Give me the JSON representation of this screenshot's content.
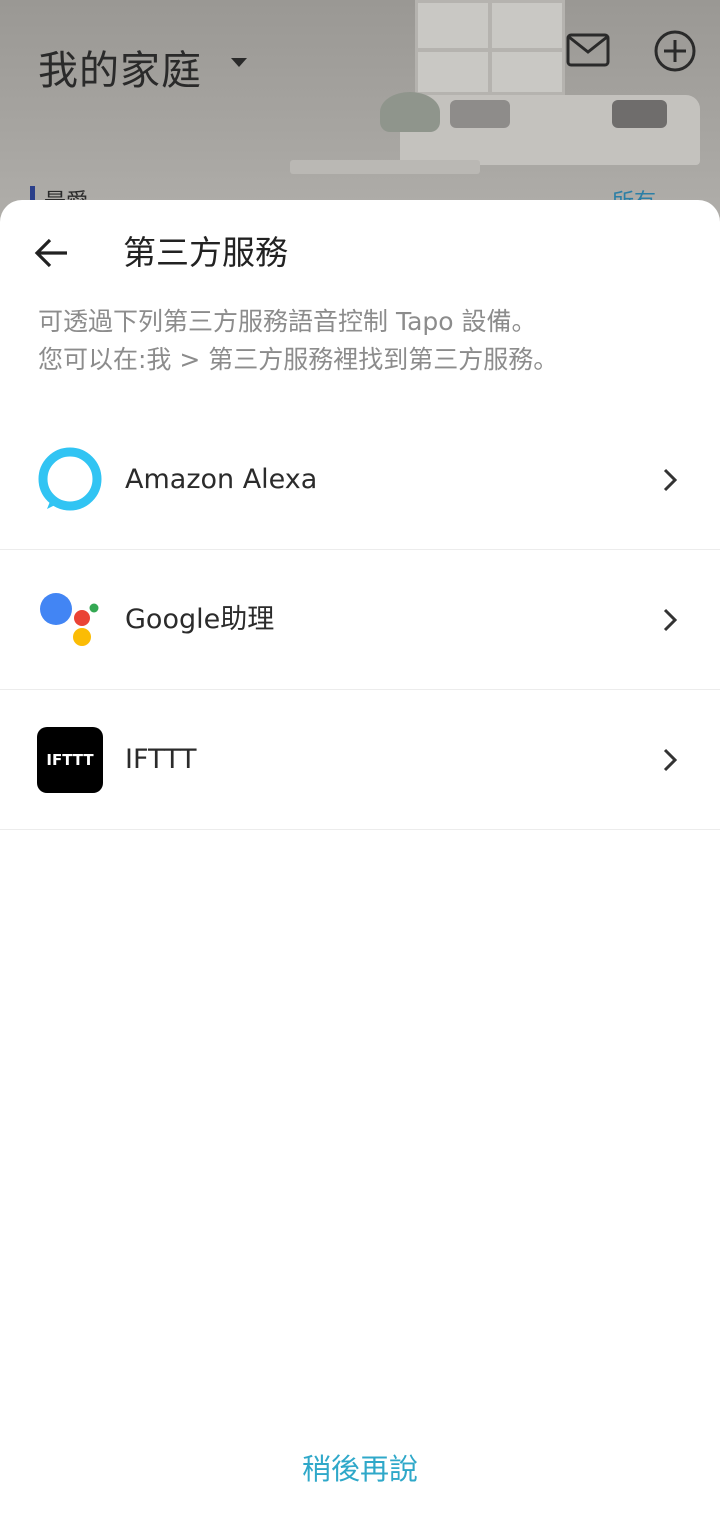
{
  "background": {
    "home_title": "我的家庭",
    "favorites_label": "最愛",
    "all_label": "所有"
  },
  "sheet": {
    "title": "第三方服務",
    "description_line1": "可透過下列第三方服務語音控制 Tapo 設備。",
    "description_line2": "您可以在:我 > 第三方服務裡找到第三方服務。",
    "services": [
      {
        "label": "Amazon Alexa",
        "icon": "alexa-icon"
      },
      {
        "label": "Google助理",
        "icon": "google-assistant-icon"
      },
      {
        "label": "IFTTT",
        "icon": "ifttt-icon",
        "icon_text": "IFTTT"
      }
    ],
    "later_button": "稍後再說"
  },
  "colors": {
    "accent": "#2fa8c9",
    "alexa": "#31c4f3",
    "google_blue": "#4285f4",
    "google_red": "#ea4335",
    "google_yellow": "#fbbc05",
    "google_green": "#34a853"
  }
}
